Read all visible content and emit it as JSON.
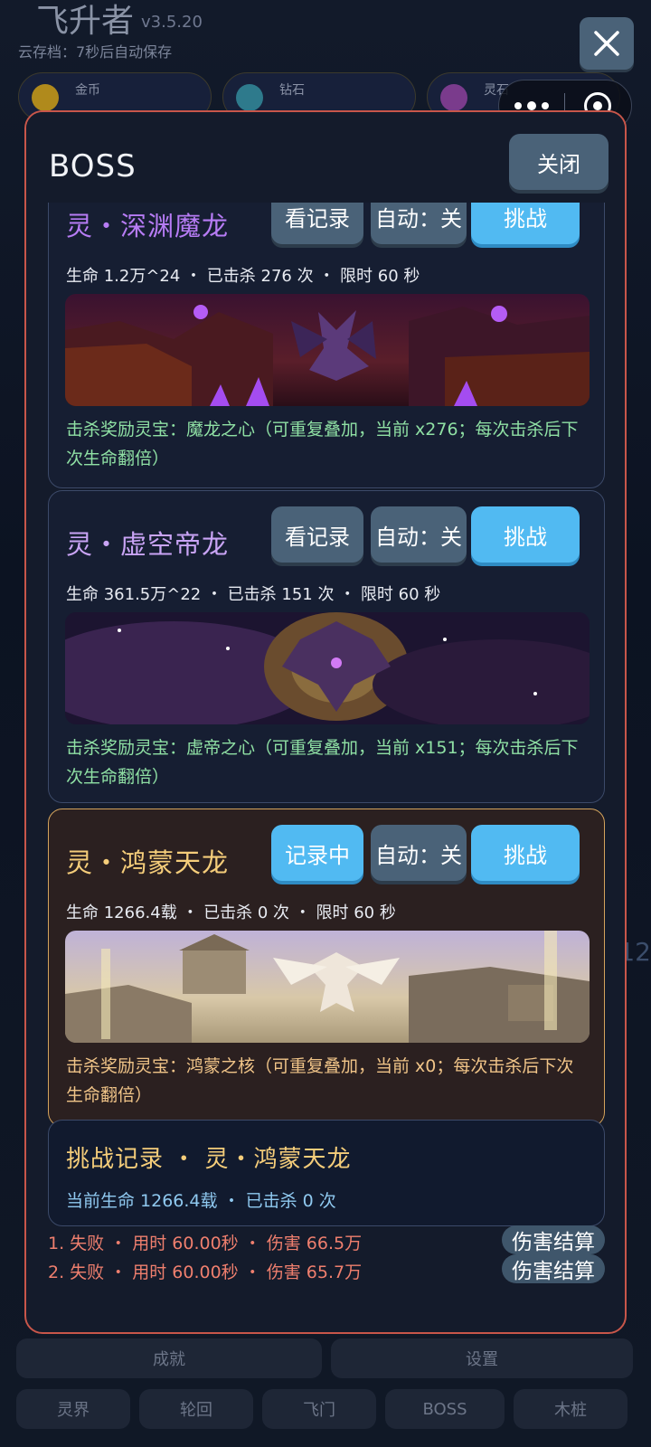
{
  "background": {
    "title": "飞升者",
    "version": "v3.5.20",
    "cloud_save": "云存档：7秒后自动保存",
    "resources": [
      {
        "label": "金币",
        "icon": "gold-coin-icon"
      },
      {
        "label": "钻石",
        "icon": "diamond-icon"
      },
      {
        "label": "灵石",
        "icon": "spirit-stone-icon"
      }
    ],
    "side_number": "12",
    "row1": [
      "成就",
      "设置"
    ],
    "row2": [
      "灵界",
      "轮回",
      "飞门",
      "BOSS",
      "木桩"
    ]
  },
  "modal": {
    "title": "BOSS",
    "close_label": "关闭"
  },
  "bosses": [
    {
      "name": "灵・深渊魔龙",
      "record_label": "看记录",
      "auto_label": "自动：关",
      "challenge_label": "挑战",
      "stats": "生命 1.2万^24 ・ 已击杀 276 次 ・ 限时 60 秒",
      "reward": "击杀奖励灵宝：魔龙之心（可重复叠加，当前 x276；每次击杀后下次生命翻倍）",
      "name_color": "#b77cf5"
    },
    {
      "name": "灵・虚空帝龙",
      "record_label": "看记录",
      "auto_label": "自动：关",
      "challenge_label": "挑战",
      "stats": "生命 361.5万^22 ・ 已击杀 151 次 ・ 限时 60 秒",
      "reward": "击杀奖励灵宝：虚帝之心（可重复叠加，当前 x151；每次击杀后下次生命翻倍）",
      "name_color": "#c9a4f5"
    },
    {
      "name": "灵・鸿蒙天龙",
      "record_label": "记录中",
      "auto_label": "自动：关",
      "challenge_label": "挑战",
      "stats": "生命 1266.4载 ・ 已击杀 0 次 ・ 限时 60 秒",
      "reward": "击杀奖励灵宝：鸿蒙之核（可重复叠加，当前 x0；每次击杀后下次生命翻倍）",
      "name_color": "#f5cd7a"
    }
  ],
  "record": {
    "title": "挑战记录 ・ 灵・鸿蒙天龙",
    "subtitle": "当前生命 1266.4载 ・ 已击杀 0 次",
    "entries": [
      {
        "text": "1. 失败 ・ 用时 60.00秒 ・ 伤害 66.5万",
        "button": "伤害结算"
      },
      {
        "text": "2. 失败 ・ 用时 60.00秒 ・ 伤害 65.7万",
        "button": "伤害结算"
      }
    ]
  },
  "colors": {
    "modal_border": "#c8564a",
    "button_grey": "#4a6278",
    "button_blue": "#51baf2",
    "reward_green": "#8fe0a4",
    "log_red": "#ef7f6e"
  }
}
